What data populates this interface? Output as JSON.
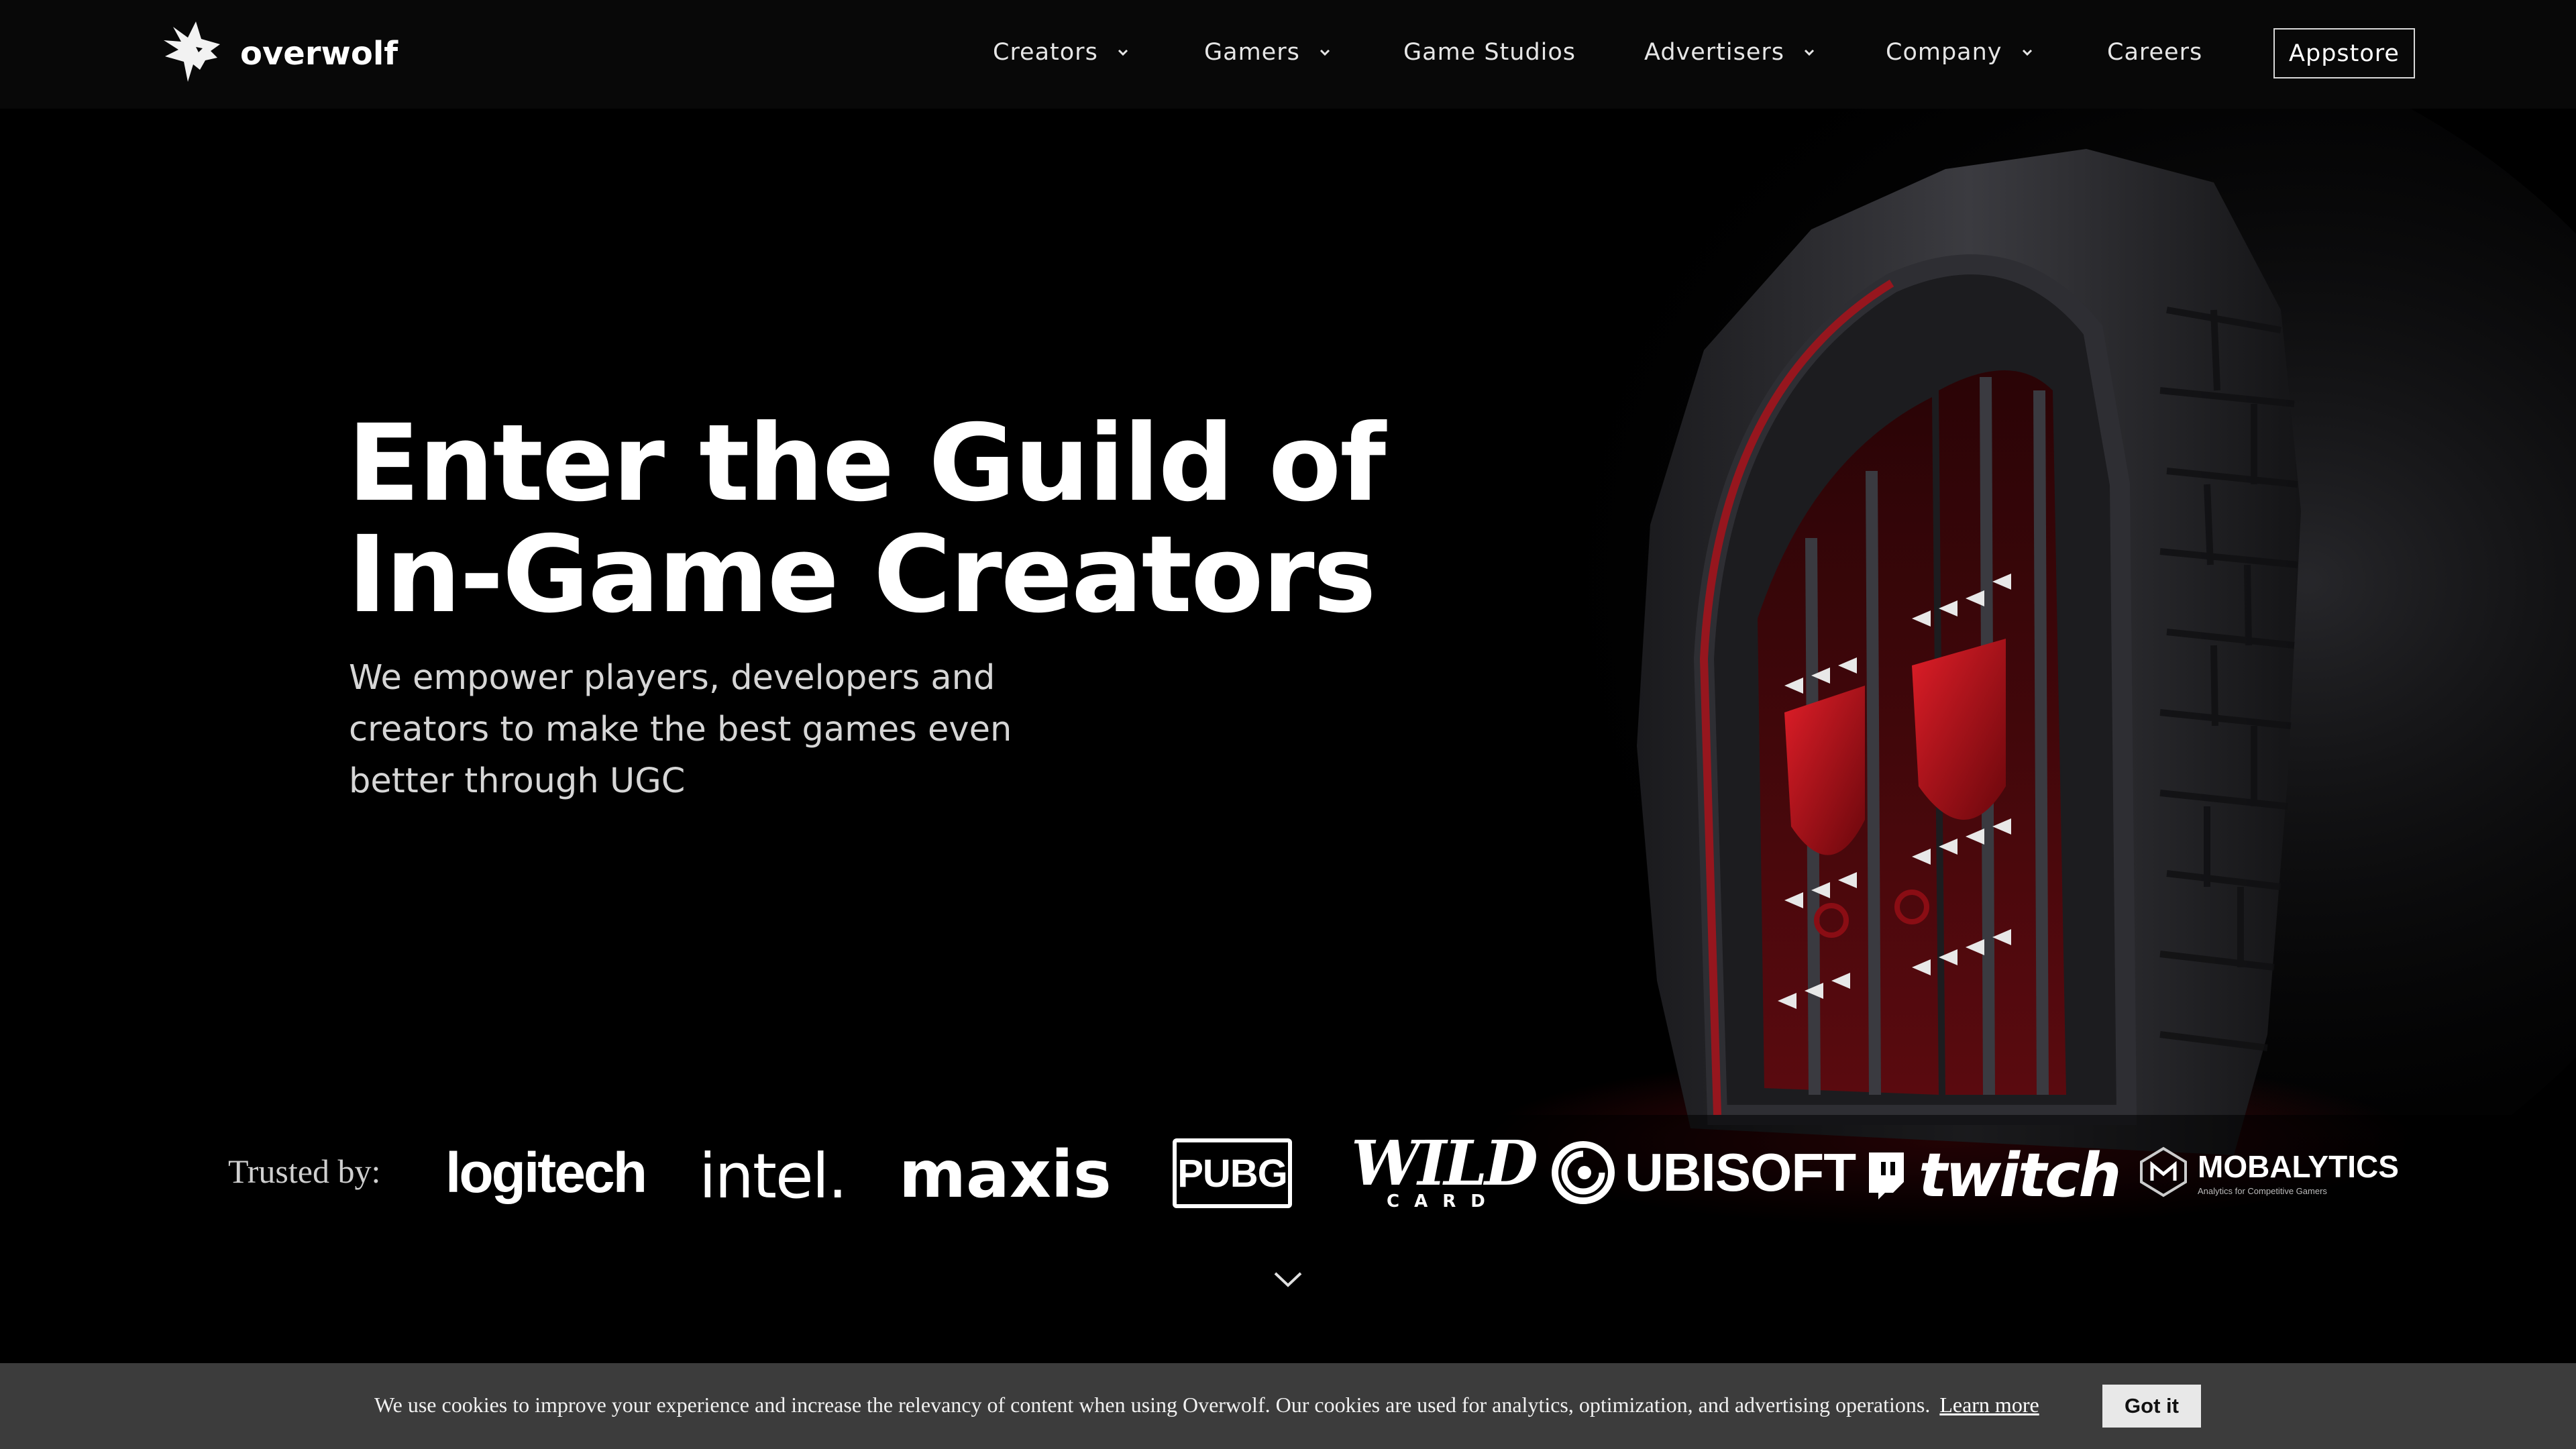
{
  "brand": {
    "name": "overwolf",
    "icon": "wolf-head-icon"
  },
  "nav": {
    "items": [
      {
        "label": "Creators",
        "dropdown": true
      },
      {
        "label": "Gamers",
        "dropdown": true
      },
      {
        "label": "Game Studios",
        "dropdown": false
      },
      {
        "label": "Advertisers",
        "dropdown": true
      },
      {
        "label": "Company",
        "dropdown": true
      },
      {
        "label": "Careers",
        "dropdown": false
      }
    ],
    "cta": "Appstore"
  },
  "hero": {
    "headline_line1": "Enter the Guild of",
    "headline_line2": "In-Game Creators",
    "sub_line1": "We empower players, developers and",
    "sub_line2": "creators to make the best games even",
    "sub_line3": "better through UGC"
  },
  "trusted": {
    "label": "Trusted by:",
    "logos": {
      "logitech": "logitech",
      "intel": "intel.",
      "maxis": "maxis",
      "pubg": "PUBG",
      "wildcard_top": "WILD",
      "wildcard_bottom": "CARD",
      "ubisoft": "UBISOFT",
      "twitch": "twitch",
      "mobalytics": "MOBALYTICS",
      "mobalytics_tagline": "Analytics for Competitive Gamers"
    }
  },
  "cookie": {
    "text": "We use cookies to improve your experience and increase the relevancy of content when using Overwolf. Our cookies are used for analytics, optimization, and advertising operations.",
    "link": "Learn more",
    "button": "Got it"
  },
  "colors": {
    "background": "#000000",
    "nav_background": "#080808",
    "cookie_background": "#3c3c3c",
    "accent_red": "#c0141e"
  }
}
